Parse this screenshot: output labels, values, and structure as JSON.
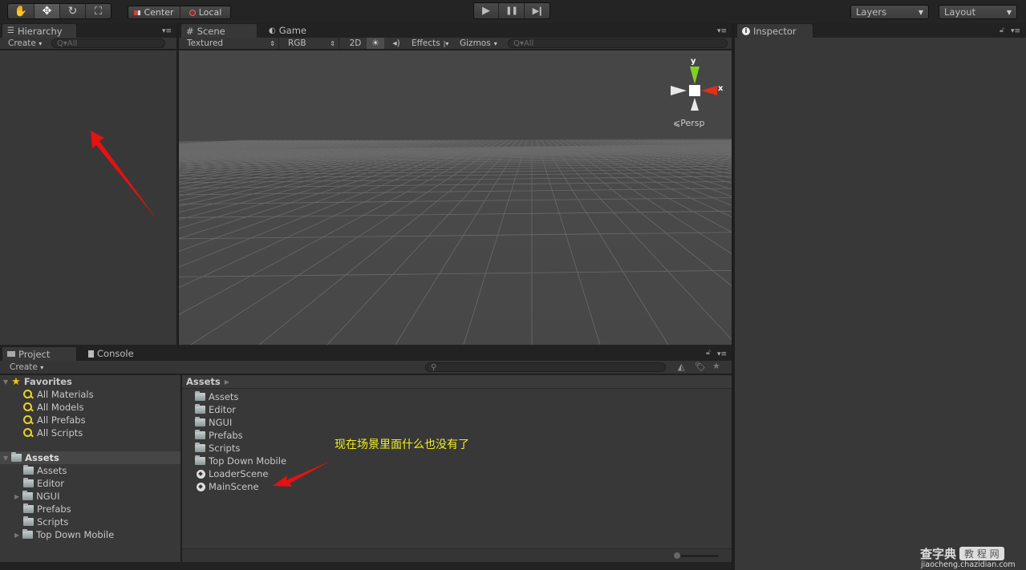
{
  "toolbar": {
    "tools": [
      {
        "icon": "hand-icon",
        "glyph": "✋"
      },
      {
        "icon": "move-icon",
        "glyph": "✥"
      },
      {
        "icon": "rotate-icon",
        "glyph": "↻"
      },
      {
        "icon": "scale-icon",
        "glyph": "⛶"
      }
    ],
    "pivot": {
      "center_label": "Center",
      "local_label": "Local"
    },
    "play": {
      "play_glyph": "▶",
      "pause_glyph": "❚❚",
      "step_glyph": "▶❙"
    },
    "layers_label": "Layers",
    "layout_label": "Layout"
  },
  "hierarchy": {
    "tab_label": "Hierarchy",
    "create_label": "Create",
    "search_placeholder": "Q▾All"
  },
  "scene": {
    "tabs": [
      {
        "label": "Scene"
      },
      {
        "label": "Game"
      }
    ],
    "toolbar": {
      "render_mode": "Textured",
      "color_mode": "RGB",
      "mode_2d": "2D",
      "effects_label": "Effects",
      "gizmos_label": "Gizmos",
      "search_placeholder": "Q▾All"
    },
    "gizmo": {
      "y_label": "y",
      "x_label": "x",
      "projection_label": "Persp"
    }
  },
  "inspector": {
    "tab_label": "Inspector"
  },
  "project": {
    "tabs": [
      {
        "label": "Project"
      },
      {
        "label": "Console"
      }
    ],
    "create_label": "Create",
    "favorites": {
      "label": "Favorites",
      "items": [
        "All Materials",
        "All Models",
        "All Prefabs",
        "All Scripts"
      ]
    },
    "assets_tree": {
      "label": "Assets",
      "items": [
        {
          "label": "Assets",
          "expandable": false
        },
        {
          "label": "Editor",
          "expandable": false
        },
        {
          "label": "NGUI",
          "expandable": true
        },
        {
          "label": "Prefabs",
          "expandable": false
        },
        {
          "label": "Scripts",
          "expandable": false
        },
        {
          "label": "Top Down Mobile",
          "expandable": true
        }
      ]
    },
    "breadcrumb": "Assets",
    "files": [
      {
        "label": "Assets",
        "type": "folder"
      },
      {
        "label": "Editor",
        "type": "folder"
      },
      {
        "label": "NGUI",
        "type": "folder"
      },
      {
        "label": "Prefabs",
        "type": "folder"
      },
      {
        "label": "Scripts",
        "type": "folder"
      },
      {
        "label": "Top Down Mobile",
        "type": "folder"
      },
      {
        "label": "LoaderScene",
        "type": "scene"
      },
      {
        "label": "MainScene",
        "type": "scene"
      }
    ]
  },
  "annotation": {
    "text": "现在场景里面什么也没有了",
    "color": "#f0f020",
    "arrow_color": "#e81010"
  },
  "watermark": {
    "brand": "查字典",
    "badge": "教 程 网",
    "url": "jiaocheng.chazidian.com"
  }
}
